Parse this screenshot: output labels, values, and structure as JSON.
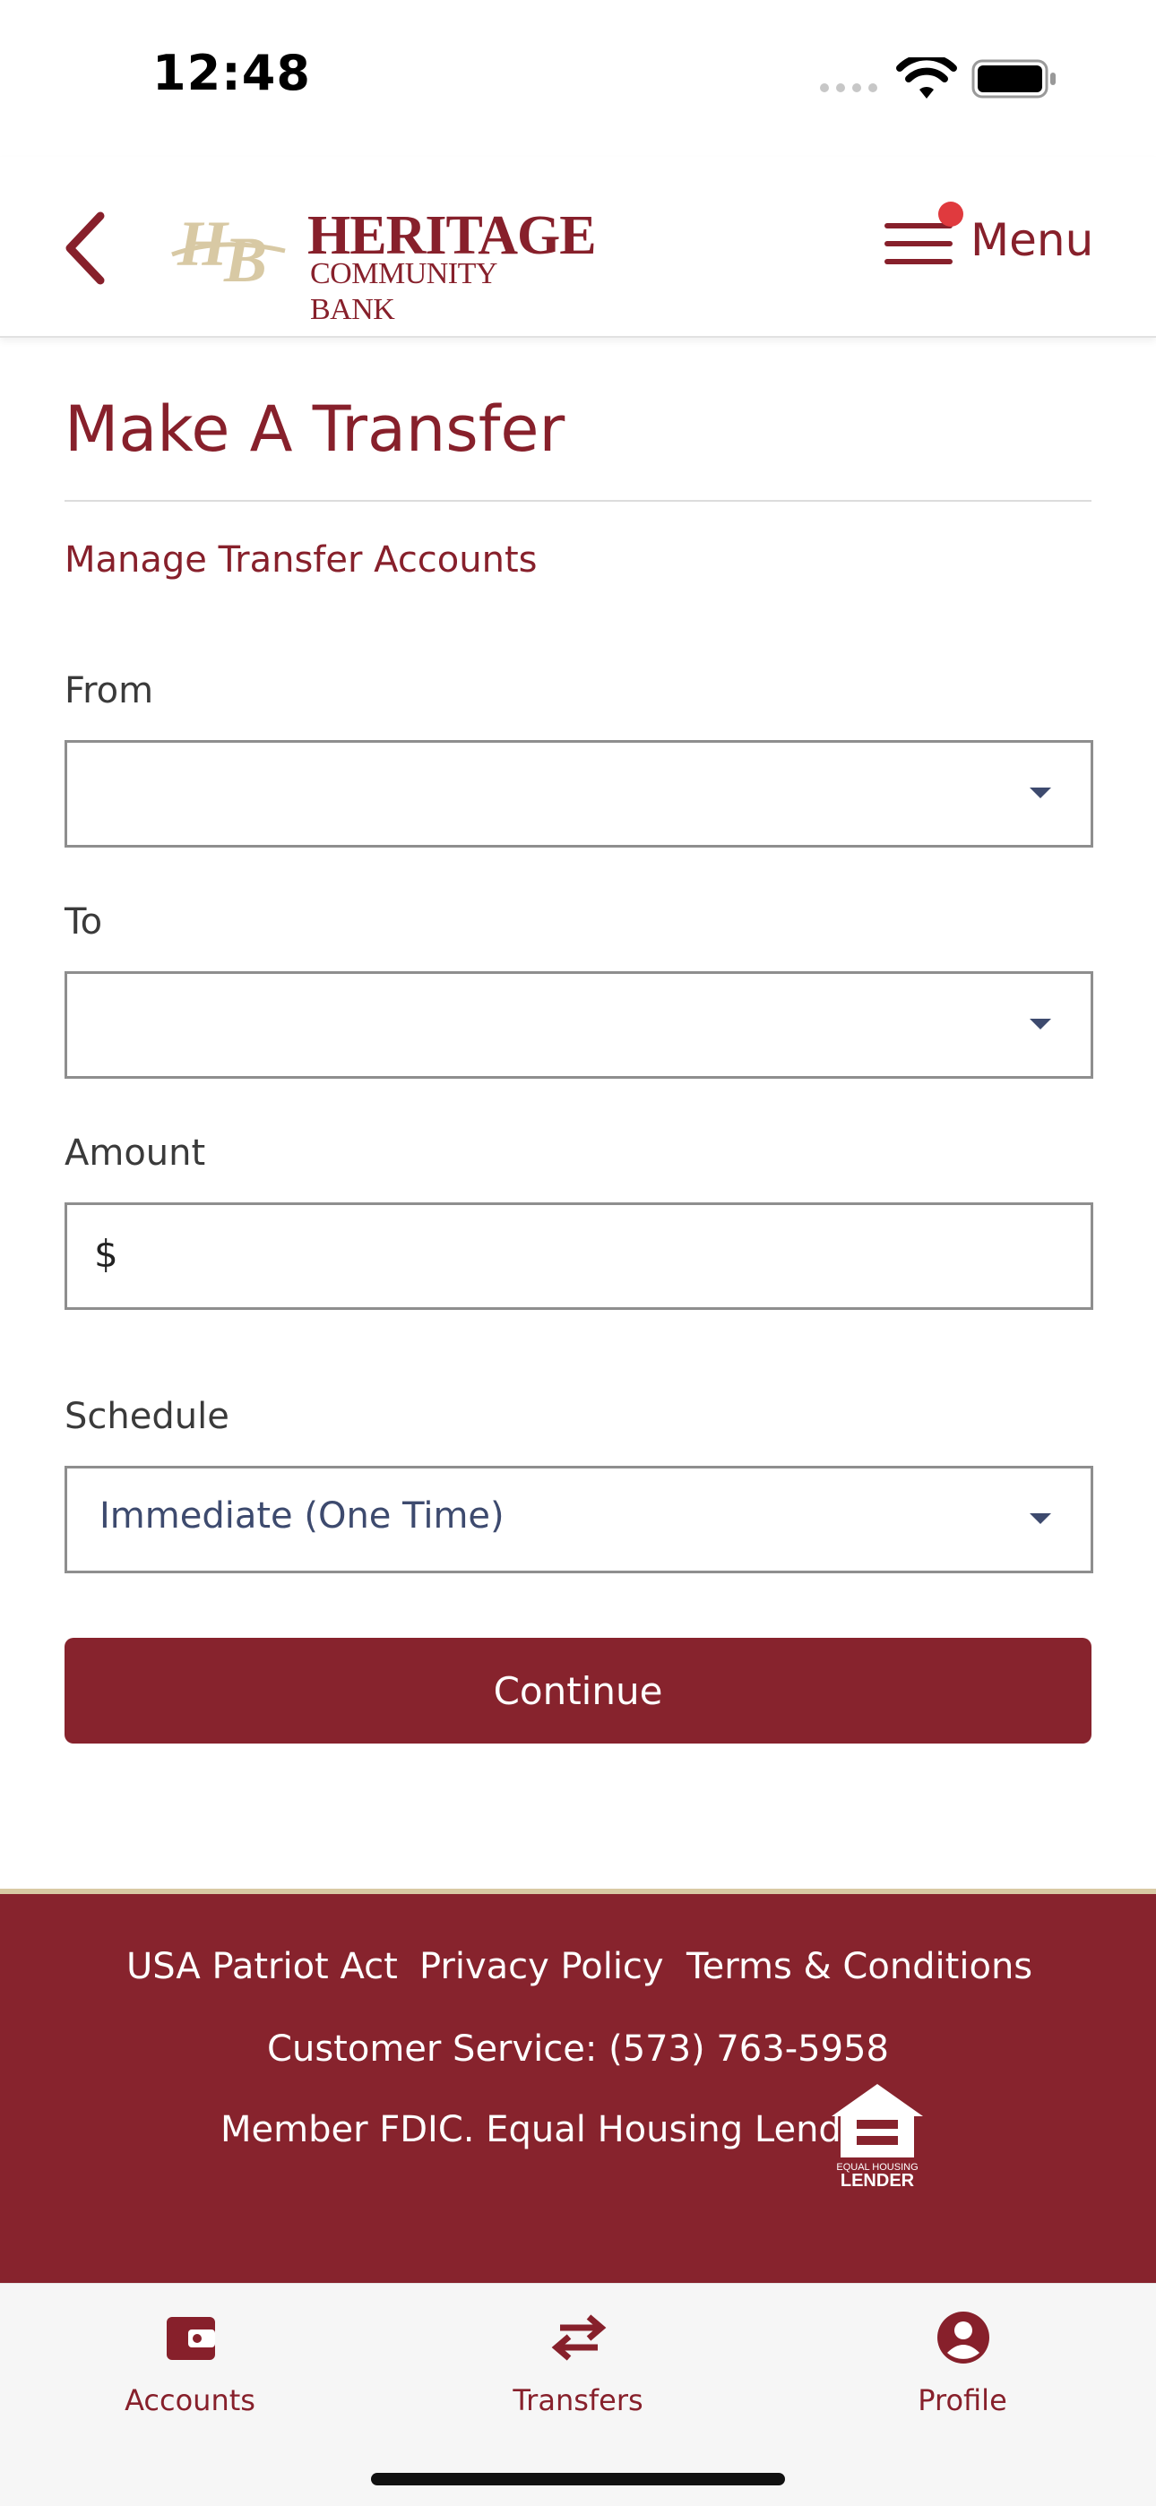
{
  "status_bar": {
    "time": "12:48"
  },
  "header": {
    "logo_main": "HERITAGE",
    "logo_sub": "COMMUNITY BANK",
    "menu_label": "Menu"
  },
  "page": {
    "title": "Make A Transfer",
    "manage_link": "Manage Transfer Accounts"
  },
  "form": {
    "from_label": "From",
    "from_value": "",
    "to_label": "To",
    "to_value": "",
    "amount_label": "Amount",
    "amount_prefix": "$",
    "amount_value": "",
    "schedule_label": "Schedule",
    "schedule_value": "Immediate (One Time)",
    "continue_label": "Continue"
  },
  "footer": {
    "links": [
      "USA Patriot Act",
      "Privacy Policy",
      "Terms & Conditions"
    ],
    "customer_service": "Customer Service: (573) 763-5958",
    "member": "Member FDIC. Equal Housing Lender",
    "eh_logo_text": "EQUAL HOUSING LENDER"
  },
  "tabs": [
    {
      "label": "Accounts",
      "icon": "wallet-icon"
    },
    {
      "label": "Transfers",
      "icon": "transfer-arrows-icon"
    },
    {
      "label": "Profile",
      "icon": "profile-icon"
    }
  ],
  "colors": {
    "brand": "#87232d",
    "accent_gold": "#d8c9a4",
    "notification": "#e03a3e"
  }
}
